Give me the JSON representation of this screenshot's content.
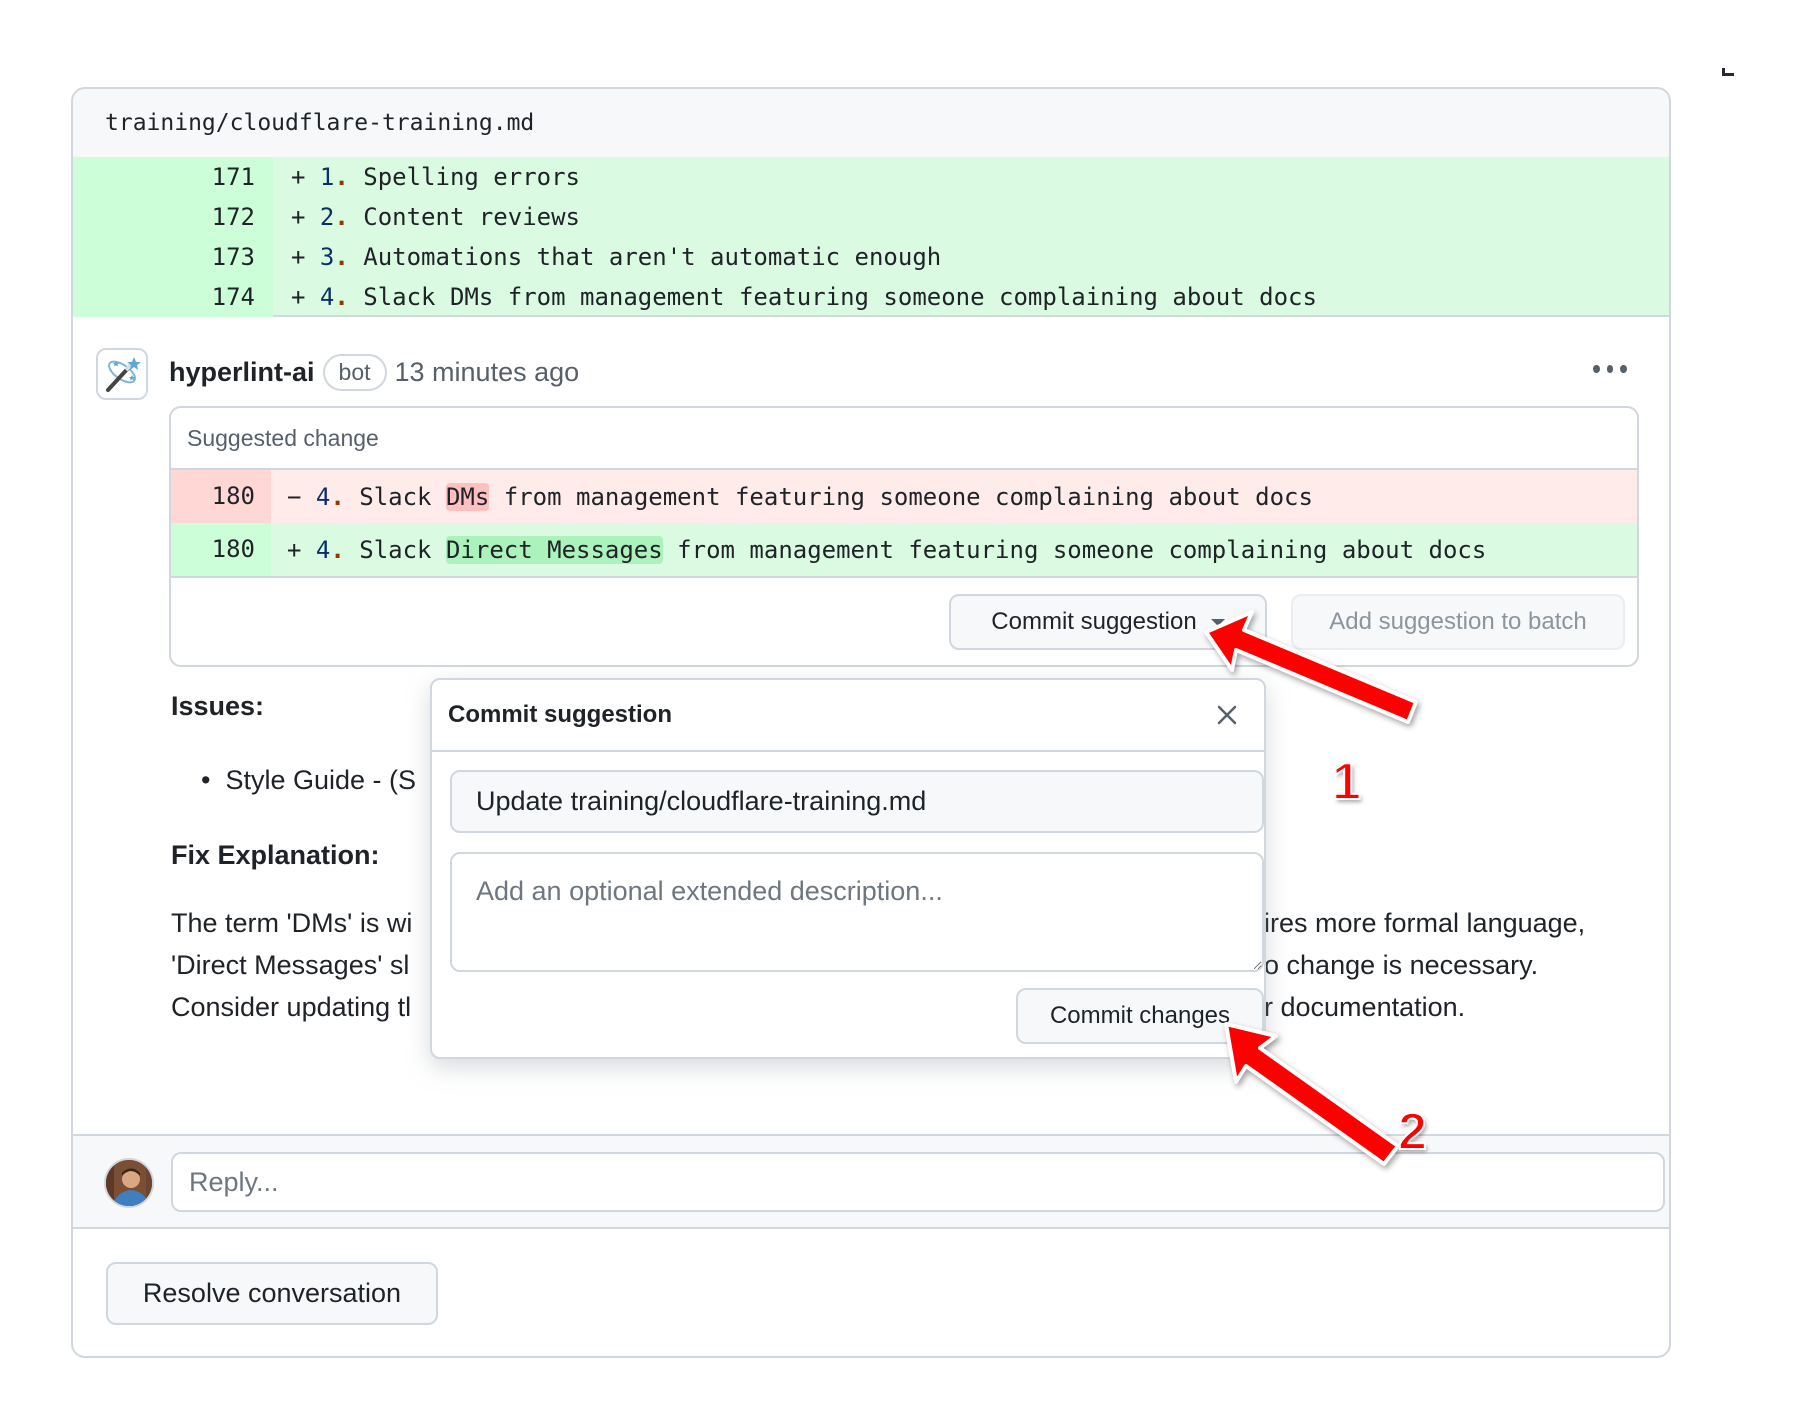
{
  "file": {
    "path": "training/cloudflare-training.md",
    "lines": [
      {
        "number": "171",
        "sign": "+",
        "item": "1",
        "text": " Spelling errors"
      },
      {
        "number": "172",
        "sign": "+",
        "item": "2",
        "text": " Content reviews"
      },
      {
        "number": "173",
        "sign": "+",
        "item": "3",
        "text": " Automations that aren't automatic enough"
      },
      {
        "number": "174",
        "sign": "+",
        "item": "4",
        "text": " Slack DMs from management featuring someone complaining about docs"
      }
    ]
  },
  "comment": {
    "author": "hyperlint-ai",
    "badge": "bot",
    "time": "13 minutes ago",
    "suggestion": {
      "title": "Suggested change",
      "removed": {
        "number": "180",
        "sign": "−",
        "item": "4",
        "before": " Slack ",
        "highlight": "DMs",
        "after": " from management featuring someone complaining about docs"
      },
      "added": {
        "number": "180",
        "sign": "+",
        "item": "4",
        "before": " Slack ",
        "highlight": "Direct Messages",
        "after": " from management featuring someone complaining about docs"
      },
      "commit_button": "Commit suggestion",
      "batch_button": "Add suggestion to batch"
    },
    "issues_heading": "Issues:",
    "issue_item": "Style Guide - (S",
    "fix_heading": "Fix Explanation:",
    "fix_lines": [
      {
        "left": "The term 'DMs' is wi",
        "right": "uires more formal language,"
      },
      {
        "left": "'Direct Messages' sl",
        "right": "no change is necessary."
      },
      {
        "left": "Consider updating tl",
        "right": "ur documentation."
      }
    ]
  },
  "reply": {
    "placeholder": "Reply..."
  },
  "resolve_button": "Resolve conversation",
  "popup": {
    "title": "Commit suggestion",
    "commit_title_value": "Update training/cloudflare-training.md",
    "description_placeholder": "Add an optional extended description...",
    "commit_button": "Commit changes"
  },
  "annotations": {
    "label_1": "1",
    "label_2": "2",
    "color": "#ff0000"
  }
}
